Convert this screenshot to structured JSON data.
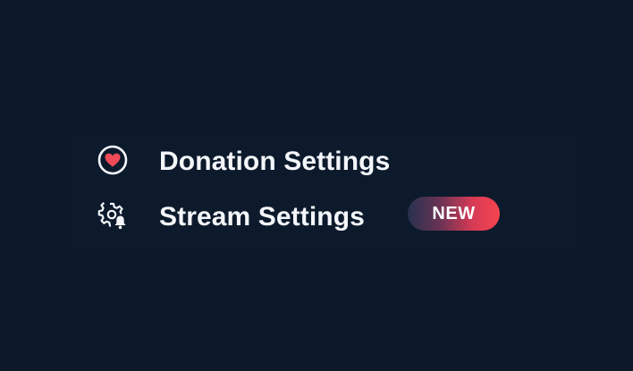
{
  "menu": {
    "items": [
      {
        "label": "Donation Settings",
        "icon": "heart-icon"
      },
      {
        "label": "Stream Settings",
        "icon": "gear-bell-icon",
        "badge": "NEW"
      }
    ]
  },
  "colors": {
    "background": "#0d1829",
    "panel": "#0c1a2c",
    "text": "#f4f6fa",
    "heart": "#ee4a57",
    "badge_start": "#27314f",
    "badge_end": "#f6444f"
  }
}
